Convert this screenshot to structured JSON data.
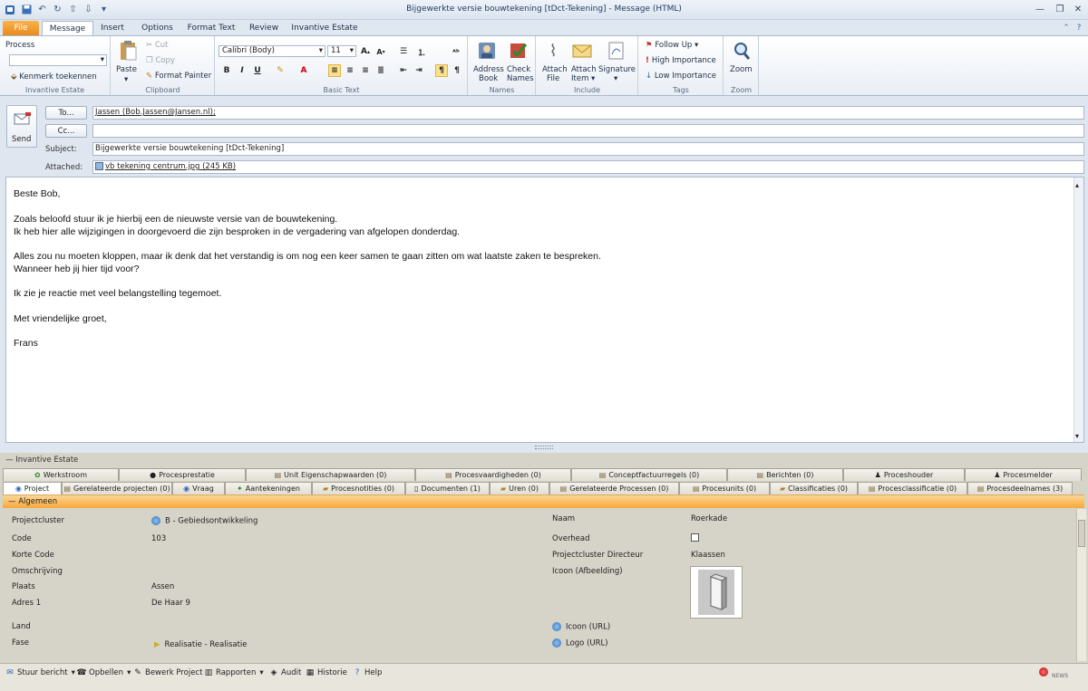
{
  "window": {
    "title": "Bijgewerkte versie bouwtekening [tDct-Tekening] - Message (HTML)",
    "minimize": "—",
    "maximize": "❐",
    "close": "✕"
  },
  "ribbon_tabs": [
    "File",
    "Message",
    "Insert",
    "Options",
    "Format Text",
    "Review",
    "Invantive Estate"
  ],
  "ribbon": {
    "estate": {
      "process_label": "Process",
      "kenmerk": "Kenmerk toekennen",
      "group": "Invantive Estate"
    },
    "clipboard": {
      "paste": "Paste",
      "cut": "Cut",
      "copy": "Copy",
      "format_painter": "Format Painter",
      "group": "Clipboard"
    },
    "basic_text": {
      "font": "Calibri (Body)",
      "size": "11",
      "group": "Basic Text"
    },
    "names": {
      "address_book_1": "Address",
      "address_book_2": "Book",
      "check_names_1": "Check",
      "check_names_2": "Names",
      "group": "Names"
    },
    "include": {
      "attach_file_1": "Attach",
      "attach_file_2": "File",
      "attach_item_1": "Attach",
      "attach_item_2": "Item ▾",
      "signature": "Signature",
      "group": "Include"
    },
    "tags": {
      "follow_up": "Follow Up ▾",
      "high": "High Importance",
      "low": "Low Importance",
      "group": "Tags"
    },
    "zoom": {
      "label": "Zoom",
      "group": "Zoom"
    }
  },
  "compose": {
    "send": "Send",
    "to_button": "To...",
    "to_value": "Jassen (Bob.Jassen@Jansen.nl);",
    "cc_button": "Cc...",
    "cc_value": "",
    "subject_label": "Subject:",
    "subject_value": "Bijgewerkte versie bouwtekening [tDct-Tekening]",
    "attached_label": "Attached:",
    "attachment": "vb tekening centrum.jpg (245 KB)"
  },
  "body_lines": [
    "Beste Bob,",
    "Zoals beloofd stuur ik je hierbij een de nieuwste versie van de bouwtekening.",
    "Ik heb hier alle wijzigingen in doorgevoerd die zijn besproken in de vergadering van afgelopen donderdag.",
    "Alles zou nu moeten kloppen, maar ik denk dat het verstandig is om nog een keer samen te gaan zitten om wat laatste zaken te bespreken.",
    "Wanneer heb jij hier tijd voor?",
    "Ik zie je reactie met veel belangstelling tegemoet.",
    "Met vriendelijke groet,",
    "Frans"
  ],
  "estate": {
    "title": "— Invantive Estate",
    "tabs_row1": [
      "Werkstroom",
      "Procesprestatie",
      "Unit Eigenschapwaarden (0)",
      "Procesvaardigheden (0)",
      "Conceptfactuurregels (0)",
      "Berichten (0)",
      "Proceshouder",
      "Procesmelder"
    ],
    "tabs_row2": [
      "Project",
      "Gerelateerde projecten (0)",
      "Vraag",
      "Aantekeningen",
      "Procesnotities (0)",
      "Documenten (1)",
      "Uren (0)",
      "Gerelateerde Processen (0)",
      "Procesunits (0)",
      "Classificaties (0)",
      "Procesclassificatie (0)",
      "Procesdeelnames (3)"
    ],
    "section": "—  Algemeen",
    "left_labels": [
      "Projectcluster",
      "Code",
      "Korte Code",
      "Omschrijving",
      "Plaats",
      "Adres 1",
      "Land",
      "Fase"
    ],
    "left_values": {
      "projectcluster": "B - Gebiedsontwikkeling",
      "code": "103",
      "plaats": "Assen",
      "adres": "De Haar 9",
      "fase": "Realisatie - Realisatie"
    },
    "right_labels": [
      "Naam",
      "Overhead",
      "Projectcluster Directeur",
      "Icoon (Afbeelding)"
    ],
    "right_values": {
      "naam": "Roerkade",
      "directeur": "Klaassen"
    },
    "links": [
      "Icoon (URL)",
      "Logo (URL)"
    ]
  },
  "statusbar": [
    "Stuur bericht",
    "Opbellen",
    "Bewerk Project",
    "Rapporten",
    "Audit",
    "Historie",
    "Help"
  ],
  "colors": {
    "accent": "#f6a83e",
    "file_tab": "#e98a1c",
    "ribbon_border": "#a9b8cc"
  }
}
